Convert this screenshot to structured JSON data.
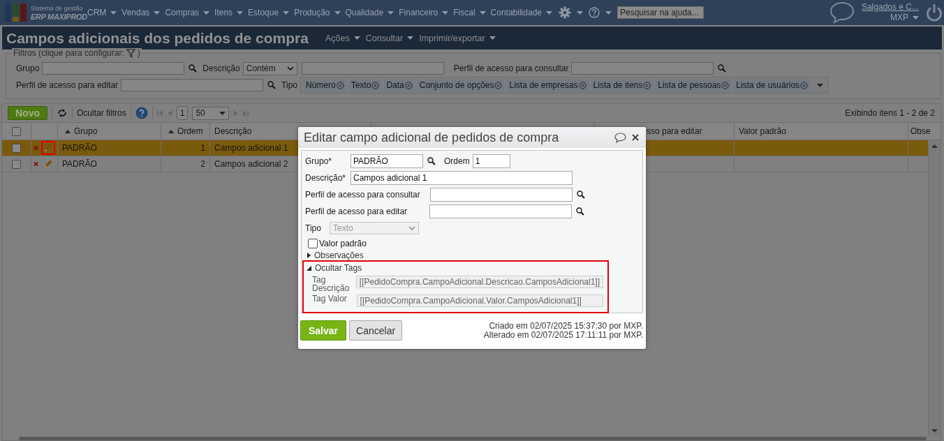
{
  "app": {
    "brand_top": "Sistema de gestão",
    "brand_bottom": "ERP MAXIPROD"
  },
  "menu": [
    "CRM",
    "Vendas",
    "Compras",
    "Itens",
    "Estoque",
    "Produção",
    "Qualidade",
    "Financeiro",
    "Fiscal",
    "Contabilidade"
  ],
  "help_search": {
    "placeholder": "Pesquisar na ajuda..."
  },
  "company": "Salgados e C...",
  "user": "MXP",
  "page": {
    "title": "Campos adicionais dos pedidos de compra",
    "actions": [
      "Ações",
      "Consultar",
      "Imprimir/exportar"
    ]
  },
  "filters": {
    "legend": "Filtros (clique para configurar:",
    "legend_end": ")",
    "grupo_label": "Grupo",
    "descricao_label": "Descrição",
    "descricao_op": "Contém",
    "consultar_label": "Perfil de acesso para consultar",
    "editar_label": "Perfil de acesso para editar",
    "tipo_label": "Tipo",
    "tipo_tags": [
      "Número",
      "Texto",
      "Data",
      "Conjunto de opções",
      "Lista de empresas",
      "Lista de itens",
      "Lista de pessoas",
      "Lista de usuários"
    ]
  },
  "toolbar": {
    "new": "Novo",
    "hide_filters": "Ocultar filtros",
    "page": "1",
    "page_size": "50",
    "summary": "Exibindo itens 1 - 2 de 2"
  },
  "table": {
    "select_all_checked": false,
    "columns": [
      {
        "label": "Grupo",
        "sorted": true
      },
      {
        "label": "Ordem",
        "sorted": true
      },
      {
        "label": "Descrição",
        "sorted": false
      },
      {
        "label": "sso para editar",
        "sorted": false
      },
      {
        "label": "Valor padrão",
        "sorted": false
      },
      {
        "label": "Obse",
        "sorted": false
      }
    ],
    "rows": [
      {
        "selected": true,
        "checked": false,
        "edit_highlighted": true,
        "grupo": "PADRÃO",
        "ordem": "1",
        "descricao": "Campos adicional 1"
      },
      {
        "selected": false,
        "checked": false,
        "edit_highlighted": false,
        "grupo": "PADRÃO",
        "ordem": "2",
        "descricao": "Campos adicional 2"
      }
    ]
  },
  "dialog": {
    "title": "Editar campo adicional de pedidos de compra",
    "grupo_label": "Grupo*",
    "grupo": "PADRÃO",
    "ordem_label": "Ordem",
    "ordem": "1",
    "descricao_label": "Descrição*",
    "descricao": "Campos adicional 1",
    "consultar_label": "Perfil de acesso para consultar",
    "editar_label": "Perfil de acesso para editar",
    "tipo_label": "Tipo",
    "tipo": "Texto",
    "tipo_disabled": true,
    "valor_padrao": {
      "label": "Valor padrão",
      "checked": false
    },
    "observacoes": {
      "label": "Observações",
      "expanded": false
    },
    "tags": {
      "label": "Ocultar Tags",
      "expanded": true,
      "highlighted": true,
      "items": [
        {
          "label": "Tag Descrição",
          "value": "[[PedidoCompra.CampoAdicional.Descricao.CamposAdicional1]]"
        },
        {
          "label": "Tag Valor",
          "value": "[[PedidoCompra.CampoAdicional.Valor.CamposAdicional1]]"
        }
      ]
    },
    "save": "Salvar",
    "cancel": "Cancelar",
    "created": "Criado em 02/07/2025 15:37:30 por MXP.",
    "altered": "Alterado em 02/07/2025 17:11:11 por MXP."
  }
}
